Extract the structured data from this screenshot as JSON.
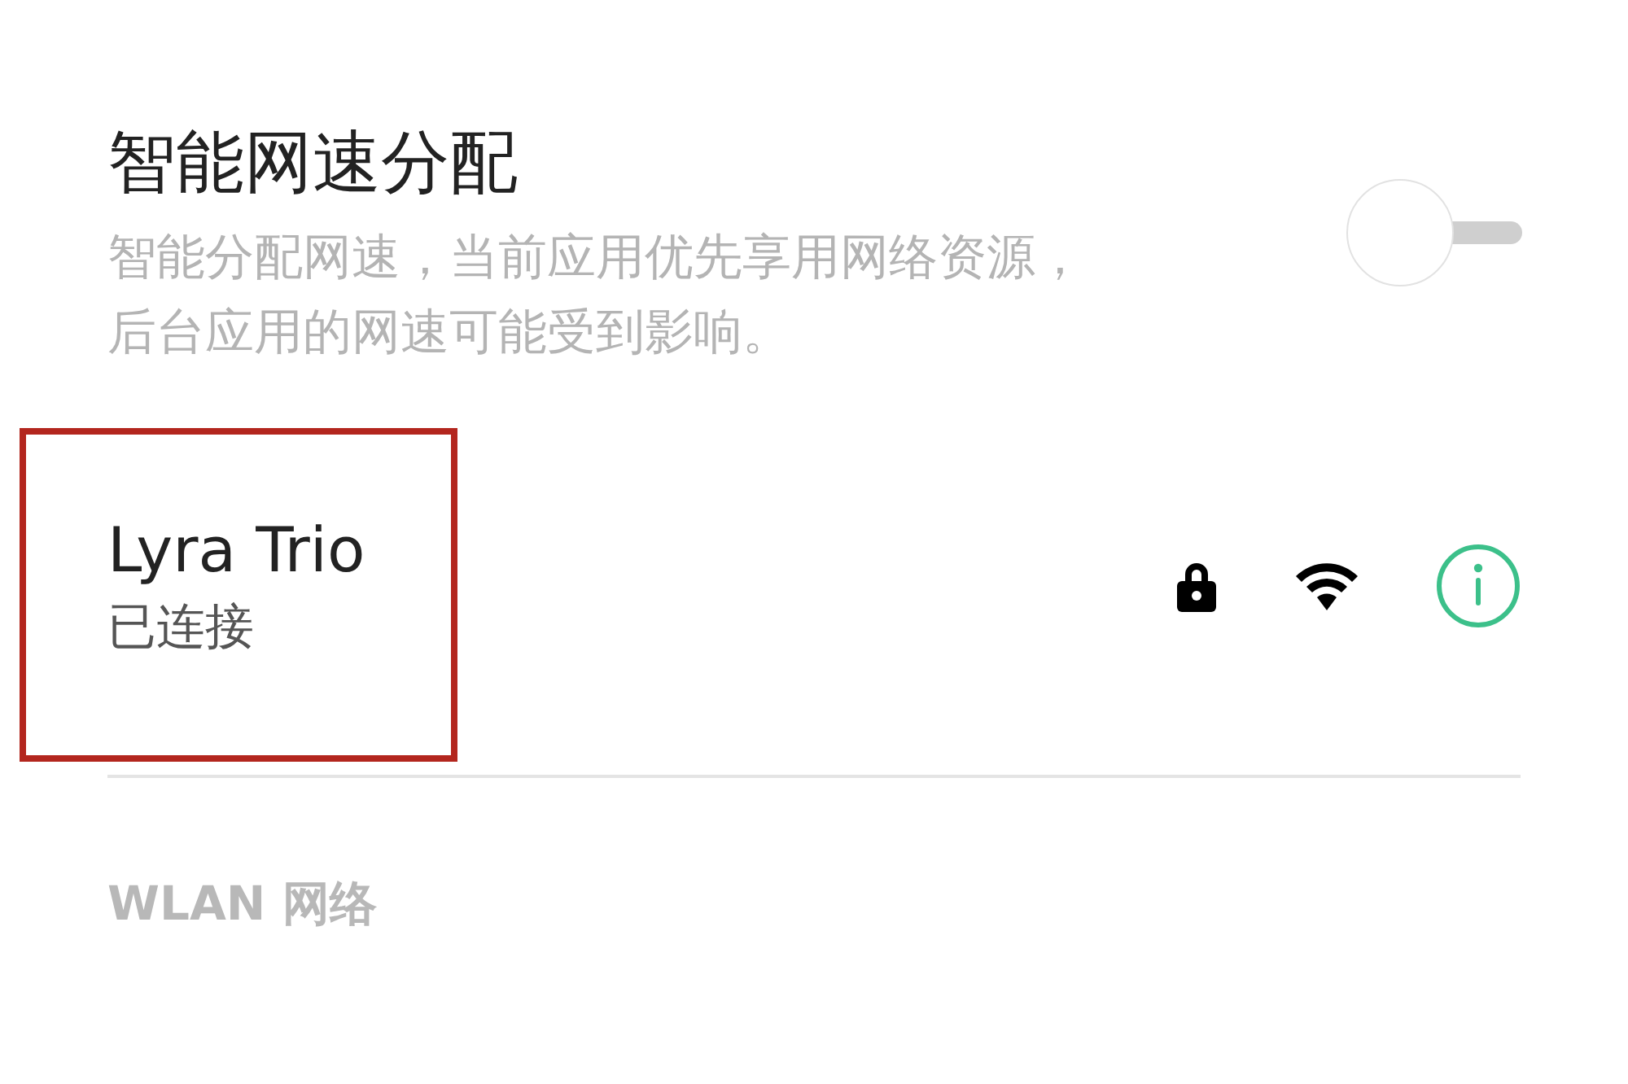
{
  "smart_speed": {
    "title": "智能网速分配",
    "description": "智能分配网速，当前应用优先享用网络资源，后台应用的网速可能受到影响。",
    "on": false
  },
  "connected_network": {
    "name": "Lyra Trio",
    "status": "已连接",
    "secured": true,
    "highlighted": true
  },
  "section_header": "WLAN 网络"
}
